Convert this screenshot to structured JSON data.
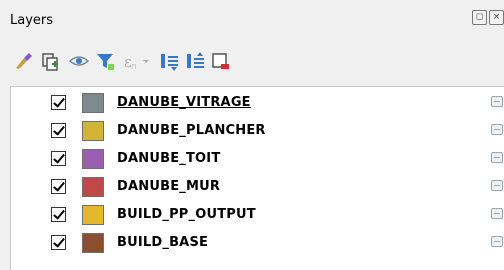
{
  "panel": {
    "title": "Layers",
    "float_icon": "float-icon",
    "close_icon": "close-icon"
  },
  "toolbar": {
    "tools": [
      {
        "name": "style-manager-icon",
        "color": "#7a5ad6"
      },
      {
        "name": "add-group-icon",
        "color": "#3b8a3b"
      },
      {
        "name": "visibility-icon",
        "color": "#3b77c9"
      },
      {
        "name": "filter-legend-icon",
        "color": "#3b77c9"
      },
      {
        "name": "filter-expression-icon",
        "color": "#b0b0b0"
      },
      {
        "name": "expand-all-icon",
        "color": "#3b77c9"
      },
      {
        "name": "collapse-all-icon",
        "color": "#3b77c9"
      },
      {
        "name": "remove-layer-icon",
        "color": "#d03030"
      }
    ]
  },
  "layers": [
    {
      "name": "DANUBE_VITRAGE",
      "color": "#7e8b8c",
      "checked": true,
      "selected": true
    },
    {
      "name": "DANUBE_PLANCHER",
      "color": "#d3b43a",
      "checked": true,
      "selected": false
    },
    {
      "name": "DANUBE_TOIT",
      "color": "#9a5fb0",
      "checked": true,
      "selected": false
    },
    {
      "name": "DANUBE_MUR",
      "color": "#c04848",
      "checked": true,
      "selected": false
    },
    {
      "name": "BUILD_PP_OUTPUT",
      "color": "#e6b72c",
      "checked": true,
      "selected": false
    },
    {
      "name": "BUILD_BASE",
      "color": "#8b4f2e",
      "checked": true,
      "selected": false
    }
  ]
}
